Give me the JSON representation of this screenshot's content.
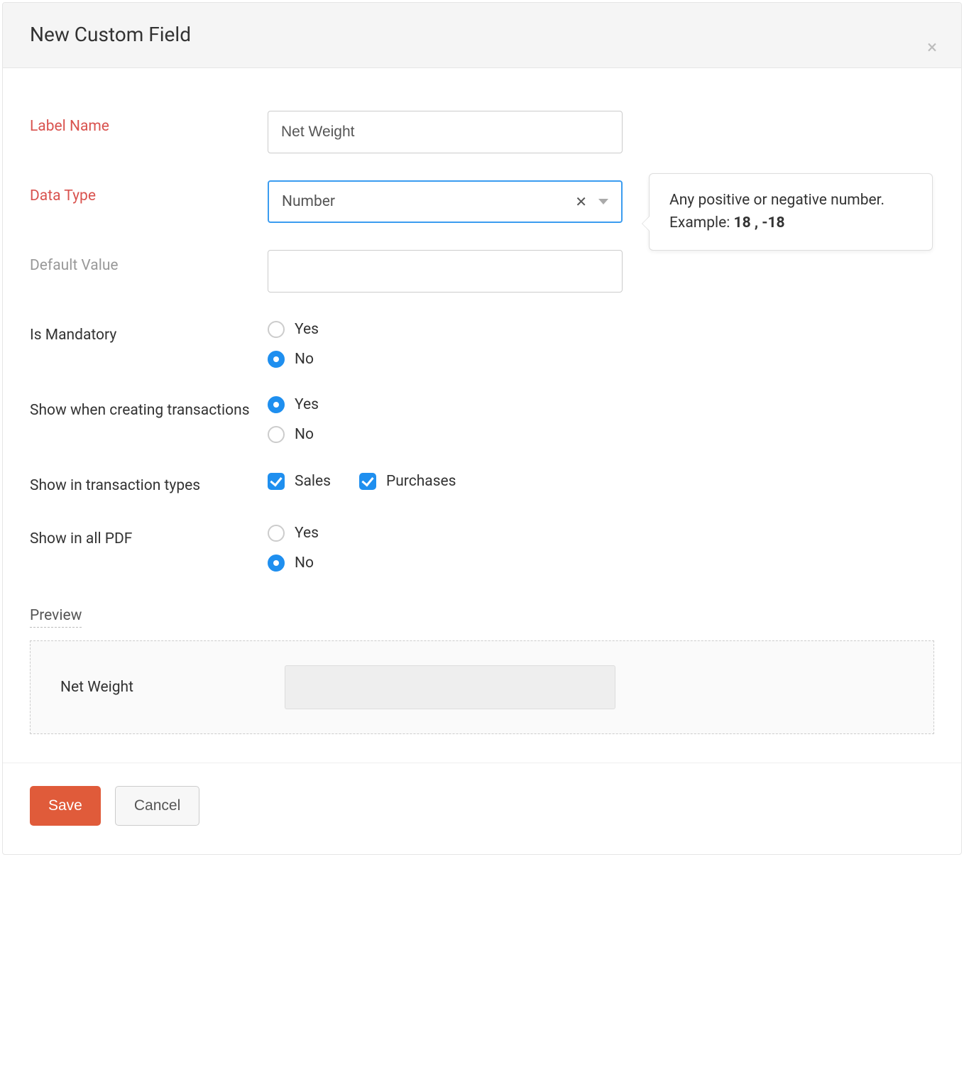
{
  "modal": {
    "title": "New Custom Field"
  },
  "form": {
    "label_name": {
      "label": "Label Name",
      "value": "Net Weight"
    },
    "data_type": {
      "label": "Data Type",
      "value": "Number"
    },
    "default_value": {
      "label": "Default Value",
      "value": ""
    },
    "is_mandatory": {
      "label": "Is Mandatory",
      "options": {
        "yes": "Yes",
        "no": "No"
      },
      "selected": "no"
    },
    "show_creating": {
      "label": "Show when creating transactions",
      "options": {
        "yes": "Yes",
        "no": "No"
      },
      "selected": "yes"
    },
    "transaction_types": {
      "label": "Show in transaction types",
      "sales": "Sales",
      "purchases": "Purchases"
    },
    "show_pdf": {
      "label": "Show in all PDF",
      "options": {
        "yes": "Yes",
        "no": "No"
      },
      "selected": "no"
    }
  },
  "tooltip": {
    "prefix": "Any positive or negative number. Example: ",
    "bold": "18 , -18"
  },
  "preview": {
    "title": "Preview",
    "label": "Net Weight"
  },
  "buttons": {
    "save": "Save",
    "cancel": "Cancel"
  }
}
